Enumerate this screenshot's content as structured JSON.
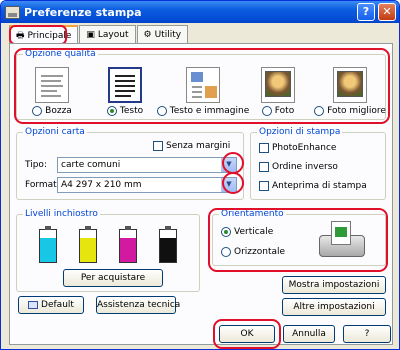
{
  "window": {
    "title": "Preferenze stampa",
    "help_label": "?",
    "close_label": "✕"
  },
  "tabs": [
    {
      "label": "Principale",
      "icon": "printer-icon"
    },
    {
      "label": "Layout",
      "icon": "layout-icon"
    },
    {
      "label": "Utility",
      "icon": "utility-icon"
    }
  ],
  "quality": {
    "title": "Opzione qualità",
    "options": [
      {
        "label": "Bozza",
        "selected": false
      },
      {
        "label": "Testo",
        "selected": true
      },
      {
        "label": "Testo e immagine",
        "selected": false
      },
      {
        "label": "Foto",
        "selected": false
      },
      {
        "label": "Foto migliore",
        "selected": false
      }
    ]
  },
  "paper": {
    "title": "Opzioni carta",
    "borderless_label": "Senza margini",
    "type_label": "Tipo:",
    "type_value": "carte comuni",
    "format_label": "Formato:",
    "format_value": "A4 297 x 210 mm"
  },
  "print_options": {
    "title": "Opzioni di stampa",
    "photoenhance": "PhotoEnhance",
    "reverse_order": "Ordine inverso",
    "preview": "Anteprima di stampa"
  },
  "ink": {
    "title": "Livelli inchiostro",
    "buy_button": "Per acquistare",
    "levels": [
      {
        "color": "#18c6e6",
        "level": 0.75
      },
      {
        "color": "#e6e60e",
        "level": 0.75
      },
      {
        "color": "#d21aa0",
        "level": 0.75
      },
      {
        "color": "#101010",
        "level": 0.75
      }
    ]
  },
  "orientation": {
    "title": "Orientamento",
    "portrait": "Verticale",
    "landscape": "Orizzontale",
    "selected": "portrait"
  },
  "buttons": {
    "default": "Default",
    "support": "Assistenza tecnica",
    "show_settings": "Mostra impostazioni",
    "more_settings": "Altre impostazioni",
    "ok": "OK",
    "cancel": "Annulla",
    "help": "?"
  },
  "colors": {
    "highlight": "#e0102a",
    "group_title": "#0046d5",
    "title_bar": "#0a5ce0"
  }
}
